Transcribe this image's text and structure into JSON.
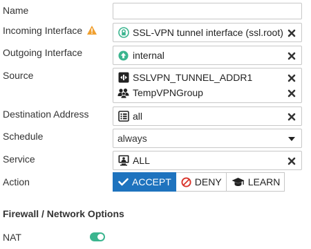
{
  "labels": {
    "name": "Name",
    "incoming_interface": "Incoming Interface",
    "outgoing_interface": "Outgoing Interface",
    "source": "Source",
    "destination_address": "Destination Address",
    "schedule": "Schedule",
    "service": "Service",
    "action": "Action",
    "nat": "NAT"
  },
  "name_field": {
    "value": "",
    "placeholder": ""
  },
  "incoming_interface": {
    "value": "SSL-VPN tunnel interface (ssl.root)",
    "icon": "ssl-vpn-interface-icon",
    "has_warning": true
  },
  "outgoing_interface": {
    "value": "internal",
    "icon": "interface-up-icon"
  },
  "source": [
    {
      "value": "SSLVPN_TUNNEL_ADDR1",
      "icon": "address-range-icon"
    },
    {
      "value": "TempVPNGroup",
      "icon": "user-group-icon"
    }
  ],
  "destination_address": {
    "value": "all",
    "icon": "address-icon"
  },
  "schedule": {
    "value": "always"
  },
  "service": {
    "value": "ALL",
    "icon": "service-icon"
  },
  "action": {
    "options": [
      "ACCEPT",
      "DENY",
      "LEARN"
    ],
    "selected": "ACCEPT"
  },
  "firewall_options": {
    "title": "Firewall / Network Options",
    "nat_enabled": true
  },
  "colors": {
    "accent": "#1e73be",
    "toggle_on": "#3bb58f",
    "warning": "#f0a030",
    "interface_green": "#3bb58f",
    "deny_red": "#d9342b"
  }
}
